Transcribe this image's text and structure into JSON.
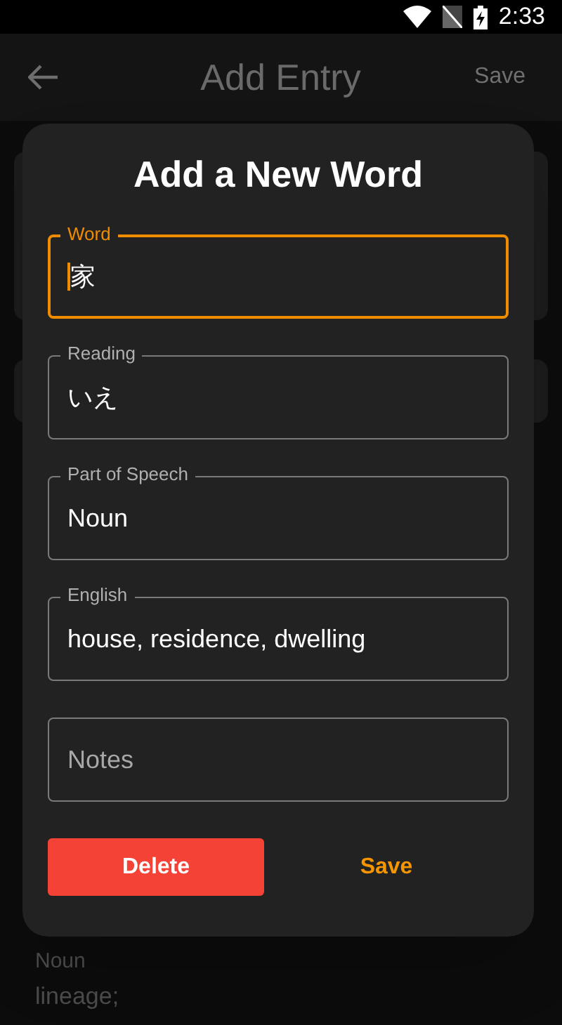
{
  "status_bar": {
    "time": "2:33"
  },
  "app_bar": {
    "title": "Add Entry",
    "action": "Save"
  },
  "background": {
    "texts": [
      "Noun",
      "lineage;"
    ]
  },
  "dialog": {
    "title": "Add a New Word",
    "fields": [
      {
        "label": "Word",
        "value": "家",
        "focused": true
      },
      {
        "label": "Reading",
        "value": "いえ",
        "focused": false
      },
      {
        "label": "Part of Speech",
        "value": "Noun",
        "focused": false
      },
      {
        "label": "English",
        "value": "house, residence, dwelling",
        "focused": false
      },
      {
        "placeholder": "Notes",
        "focused": false
      }
    ],
    "buttons": [
      {
        "label": "Delete",
        "kind": "filled"
      },
      {
        "label": "Save",
        "kind": "text"
      }
    ]
  }
}
